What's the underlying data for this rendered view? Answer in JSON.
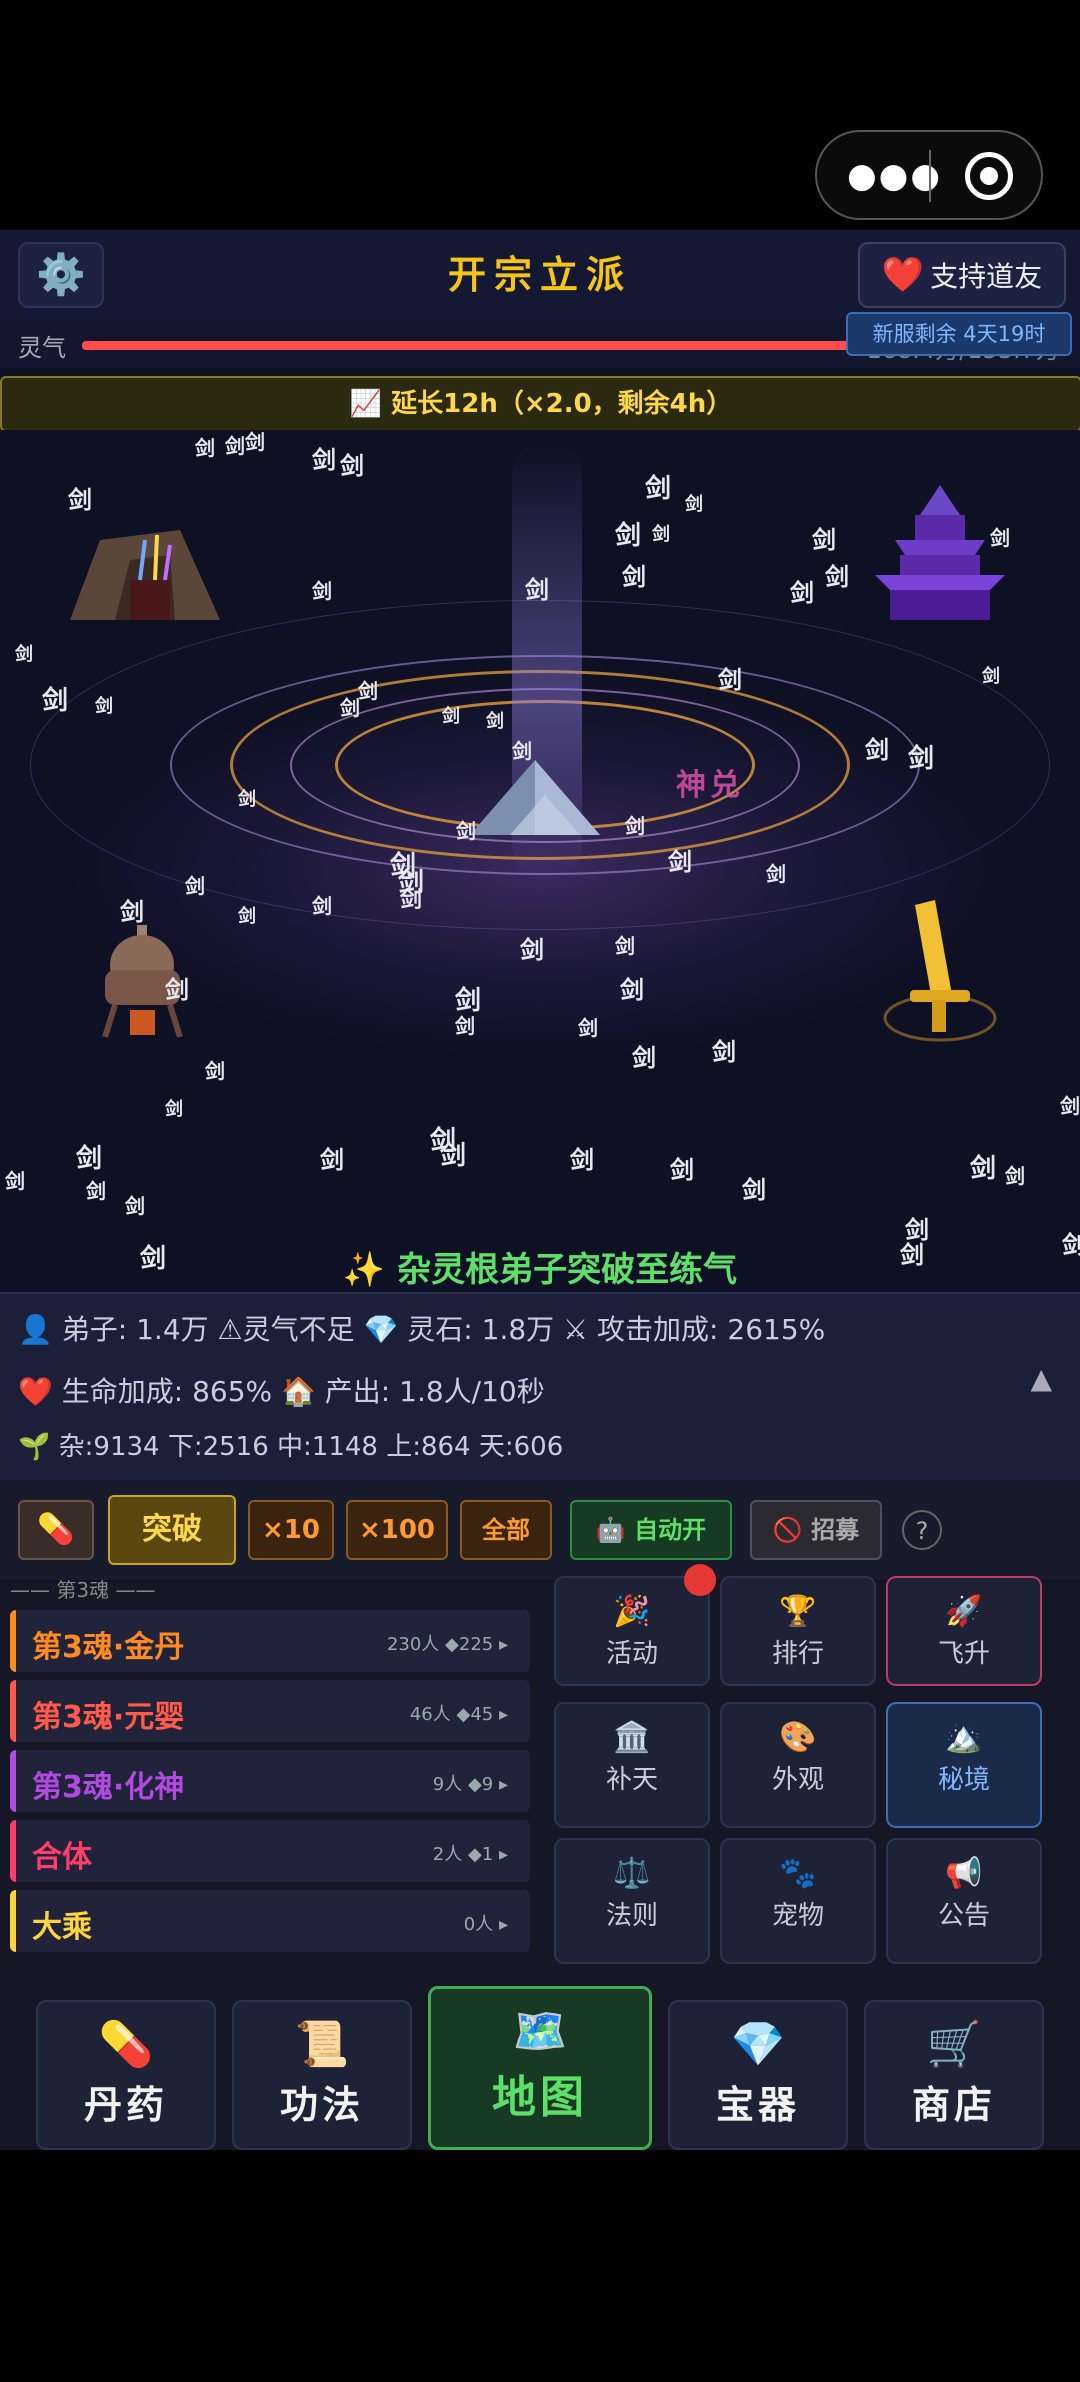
{
  "header": {
    "title": "开宗立派",
    "settings_icon": "⚙️",
    "support_label": "支持道友",
    "support_icon": "❤️"
  },
  "qi": {
    "label": "灵气",
    "value": "168.4万/153.7万",
    "server_badge": "新服剩余 4天19时",
    "fill_fraction": 1.0
  },
  "extend_banner": "📈 延长12h（×2.0，剩余4h）",
  "scene": {
    "divine_text": "神兑",
    "message": "✨ 杂灵根弟子突破至练气",
    "sword_char": "剑"
  },
  "stats": {
    "line1": "👤 弟子: 1.4万 ⚠灵气不足 💎 灵石: 1.8万 ⚔ 攻击加成: 2615%",
    "line2": "❤️ 生命加成: 865% 🏠 产出: 1.8人/10秒",
    "line3": "🌱 杂:9134 下:2516 中:1148 上:864 天:606",
    "collapse_icon": "▲"
  },
  "actions": {
    "pill_icon": "💊",
    "breakthrough": "突破",
    "x10": "×10",
    "x100": "×100",
    "all": "全部",
    "auto": "🤖 自动开",
    "recruit": "🚫 招募",
    "help": "?"
  },
  "realms": {
    "section_label": "—— 第3魂 ——",
    "items": [
      {
        "name": "第3魂·金丹",
        "count": "230人 ◆225 ▸",
        "color": "#ff8a1f"
      },
      {
        "name": "第3魂·元婴",
        "count": "46人 ◆45 ▸",
        "color": "#ff5a4a"
      },
      {
        "name": "第3魂·化神",
        "count": "9人 ◆9 ▸",
        "color": "#b04ae0"
      },
      {
        "name": "合体",
        "count": "2人 ◆1 ▸",
        "color": "#ff3d6a"
      },
      {
        "name": "大乘",
        "count": "0人 ▸",
        "color": "#ffd33a"
      }
    ]
  },
  "features": [
    {
      "icon": "🎉",
      "label": "活动"
    },
    {
      "icon": "🏆",
      "label": "排行"
    },
    {
      "icon": "🚀",
      "label": "飞升"
    },
    {
      "icon": "🏛️",
      "label": "补天"
    },
    {
      "icon": "🎨",
      "label": "外观"
    },
    {
      "icon": "🏔️",
      "label": "秘境"
    },
    {
      "icon": "⚖️",
      "label": "法则"
    },
    {
      "icon": "🐾",
      "label": "宠物"
    },
    {
      "icon": "📢",
      "label": "公告"
    }
  ],
  "nav": [
    {
      "icon": "💊",
      "label": "丹药"
    },
    {
      "icon": "📜",
      "label": "功法"
    },
    {
      "icon": "🗺️",
      "label": "地图"
    },
    {
      "icon": "💎",
      "label": "宝器"
    },
    {
      "icon": "🛒",
      "label": "商店"
    }
  ],
  "colors": {
    "title": "#f5c518",
    "accent_green": "#5de06a",
    "qi_bar": "#ff4d4d"
  }
}
